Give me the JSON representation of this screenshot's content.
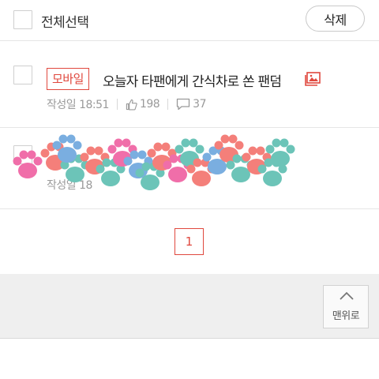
{
  "toolbar": {
    "select_all_label": "전체선택",
    "delete_label": "삭제"
  },
  "posts": [
    {
      "badge": "모바일",
      "title": "오늘자 타팬에게 간식차로 쏜 팬덤",
      "has_image": true,
      "date": "작성일 18:51",
      "likes": "198",
      "comments": "37"
    },
    {
      "date_partial": "작성일 18"
    }
  ],
  "pagination": {
    "current_page": "1"
  },
  "footer": {
    "top_button_label": "맨위로"
  },
  "colors": {
    "accent_red": "#e0483e",
    "paw_pink": "#f06ea9",
    "paw_salmon": "#f47f7a",
    "paw_teal": "#6cc4b8",
    "paw_blue": "#7aaee0"
  },
  "icons": {
    "image": "image-icon",
    "like": "thumbs-up-icon",
    "comment": "comment-bubble-icon",
    "scroll_top": "chevron-up-icon"
  }
}
